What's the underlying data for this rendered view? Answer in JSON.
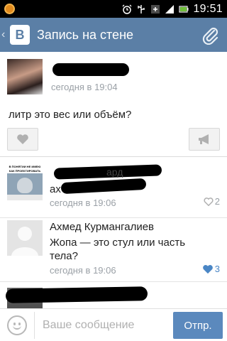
{
  "status_bar": {
    "time": "19:51",
    "icons": [
      "alarm-icon",
      "usb-icon",
      "sync-icon",
      "battery-icon",
      "signal-icon",
      "battery-charging-icon"
    ]
  },
  "app_bar": {
    "logo": "В",
    "title": "Запись на стене",
    "action_icon": "paperclip-icon"
  },
  "post": {
    "time": "сегодня в 19:04",
    "text": "литр это вес или объём?"
  },
  "comments": [
    {
      "avatar_text": "В ПОНЯТИИ НЕ ИМЕЮ КАК ПРОЕКТИРОВАТЬ",
      "name_fragment": "ард",
      "text_fragment": "ах",
      "time": "сегодня в 19:06",
      "likes": "2",
      "liked": false
    },
    {
      "name": "Ахмед Курмангалиев",
      "text": "Жопа — это стул или часть тела?",
      "time": "сегодня в 19:06",
      "likes": "3",
      "liked": true
    }
  ],
  "composer": {
    "placeholder": "Ваше сообщение",
    "send_label": "Отпр."
  },
  "colors": {
    "app_bar": "#5b7fa6",
    "send_button": "#5b89bd",
    "like_active": "#4a86c5",
    "muted": "#9aa0a6"
  }
}
